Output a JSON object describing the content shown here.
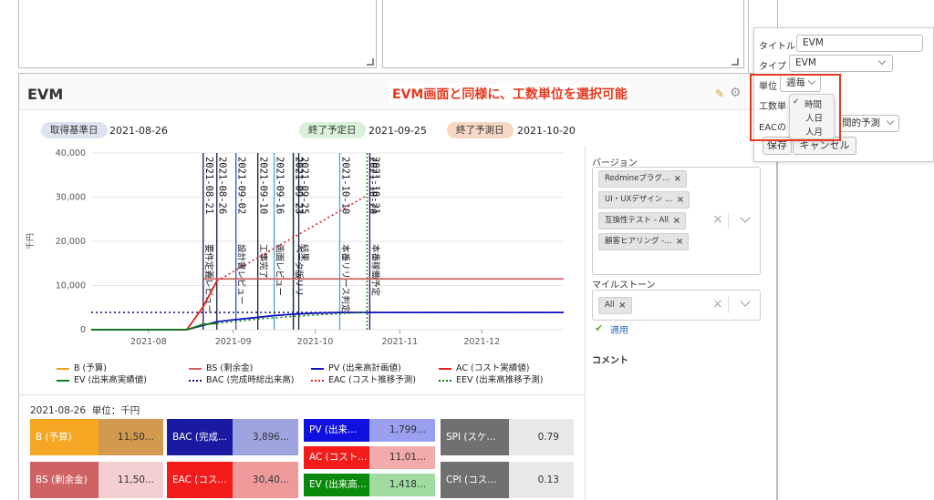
{
  "evm": {
    "title": "EVM",
    "callout": "EVM画面と同様に、工数単位を選択可能",
    "dates": {
      "base_label": "取得基準日",
      "base_value": "2021-08-26",
      "planned_label": "終了予定日",
      "planned_value": "2021-09-25",
      "forecast_label": "終了予測日",
      "forecast_value": "2021-10-20"
    },
    "legend": [
      {
        "label": "B (予算)",
        "color": "#f0a020",
        "style": "solid"
      },
      {
        "label": "BS (剩余金)",
        "color": "#d06060",
        "style": "solid"
      },
      {
        "label": "PV (出来高計画値)",
        "color": "#1010c0",
        "style": "solid"
      },
      {
        "label": "AC (コスト実績値)",
        "color": "#e02020",
        "style": "solid"
      },
      {
        "label": "EV (出来高実績値)",
        "color": "#108010",
        "style": "solid"
      },
      {
        "label": "BAC (完成時総出来高)",
        "color": "#1a1a8a",
        "style": "dotted"
      },
      {
        "label": "EAC (コスト推移予測)",
        "color": "#e02020",
        "style": "dotted"
      },
      {
        "label": "EEV (出来高推移予測)",
        "color": "#108010",
        "style": "dotted"
      }
    ],
    "summary_header": "2021-08-26  単位：千円",
    "table": {
      "b_label": "B (予算)",
      "b_value": "11,50...",
      "bs_label": "BS (剰余金)",
      "bs_value": "11,50...",
      "bac_label": "BAC (完成...",
      "bac_value": "3,896...",
      "eac_label": "EAC (コス...",
      "eac_value": "30,40...",
      "pv_label": "PV (出来...",
      "pv_value": "1,799...",
      "ac_label": "AC (コスト...",
      "ac_value": "11,01...",
      "ev_label": "EV (出来高...",
      "ev_value": "1,418...",
      "spi_label": "SPI (スケ...",
      "spi_value": "0.79",
      "cpi_label": "CPI (コス...",
      "cpi_value": "0.13"
    }
  },
  "filters": {
    "version_label": "バージョン",
    "versions": [
      "Redmineプラグ...",
      "互換性テスト - All",
      "UI・UXデザイン ...",
      "顧客ヒアリング -..."
    ],
    "milestone_label": "マイルストーン",
    "milestones": [
      "All"
    ],
    "apply_label": "適用",
    "comment_label": "コメント"
  },
  "settings": {
    "title_label": "タイトル",
    "title_value": "EVM",
    "type_label": "タイプ",
    "type_value": "EVM",
    "unit_label": "単位",
    "unit_value": "週毎",
    "work_unit_label": "工数単",
    "work_unit_options": [
      "時間",
      "人日",
      "人月"
    ],
    "work_unit_selected": "時間",
    "eac_label": "EACの",
    "eac_value": "間的予測",
    "save_label": "保存",
    "cancel_label": "キャンセル"
  },
  "chart_data": {
    "type": "line",
    "ylabel": "千円",
    "ylim": [
      0,
      40000
    ],
    "yticks": [
      "0",
      "10,000",
      "20,000",
      "30,000",
      "40,000"
    ],
    "xticks": [
      "2021-08",
      "2021-09",
      "2021-10",
      "2021-11",
      "2021-12"
    ],
    "xrange": [
      "2021-07-11",
      "2021-12-31"
    ],
    "milestones": [
      {
        "date": "2021-08-21",
        "label": "要件定義レビュー",
        "color": "#1a1a4a"
      },
      {
        "date": "2021-08-26",
        "label": "",
        "color": "#1a1a4a"
      },
      {
        "date": "2021-09-02",
        "label": "設計書レビュー",
        "color": "#3050d0"
      },
      {
        "date": "2021-09-10",
        "label": "工事完了",
        "color": "#1a1a4a"
      },
      {
        "date": "2021-09-16",
        "label": "画面レビュー",
        "color": "#50a0e0"
      },
      {
        "date": "2021-09-23",
        "label": "ベータ版リリ",
        "color": "#30c050"
      },
      {
        "date": "2021-09-23",
        "label": "",
        "color": "#1a1a4a"
      },
      {
        "date": "2021-09-25",
        "label": "結果",
        "color": "#1a1a4a"
      },
      {
        "date": "2021-10-10",
        "label": "本番リリース判定",
        "color": "#50a0e0"
      },
      {
        "date": "2021-10-20",
        "label": "",
        "color": "#108010"
      },
      {
        "date": "2021-10-21",
        "label": "本番稼働予定",
        "color": "#1a1a4a"
      }
    ],
    "series": [
      {
        "name": "BS (剰余金)",
        "color": "#d06060",
        "dash": false,
        "x": [
          "2021-08-21",
          "2021-12-31"
        ],
        "y": [
          11500,
          11500
        ]
      },
      {
        "name": "BAC (完成時総出来高)",
        "color": "#1a1a8a",
        "dash": true,
        "x": [
          "2021-07-11",
          "2021-12-31"
        ],
        "y": [
          3896,
          3896
        ]
      },
      {
        "name": "AC (コスト実績値)",
        "color": "#e02020",
        "dash": false,
        "x": [
          "2021-07-11",
          "2021-08-15",
          "2021-08-21",
          "2021-08-26"
        ],
        "y": [
          0,
          0,
          5200,
          11010
        ]
      },
      {
        "name": "EAC (コスト推移予測)",
        "color": "#e02020",
        "dash": true,
        "x": [
          "2021-08-26",
          "2021-10-20"
        ],
        "y": [
          11010,
          30400
        ]
      },
      {
        "name": "PV (出来高計画値)",
        "color": "#1010c0",
        "dash": false,
        "x": [
          "2021-07-11",
          "2021-08-15",
          "2021-08-26",
          "2021-09-02",
          "2021-09-10",
          "2021-09-16",
          "2021-09-23",
          "2021-10-01",
          "2021-10-10",
          "2021-10-20",
          "2021-12-31"
        ],
        "y": [
          0,
          0,
          1799,
          2300,
          2800,
          3200,
          3500,
          3750,
          3896,
          3896,
          3896
        ]
      },
      {
        "name": "EV (出来高実績値)",
        "color": "#108010",
        "dash": false,
        "x": [
          "2021-07-11",
          "2021-08-15",
          "2021-08-21",
          "2021-08-26"
        ],
        "y": [
          0,
          0,
          1200,
          1418
        ]
      },
      {
        "name": "EEV (出来高推移予測)",
        "color": "#108010",
        "dash": true,
        "x": [
          "2021-08-26",
          "2021-09-10",
          "2021-09-25",
          "2021-10-10",
          "2021-10-20"
        ],
        "y": [
          1418,
          2400,
          3100,
          3650,
          3896
        ]
      }
    ]
  }
}
